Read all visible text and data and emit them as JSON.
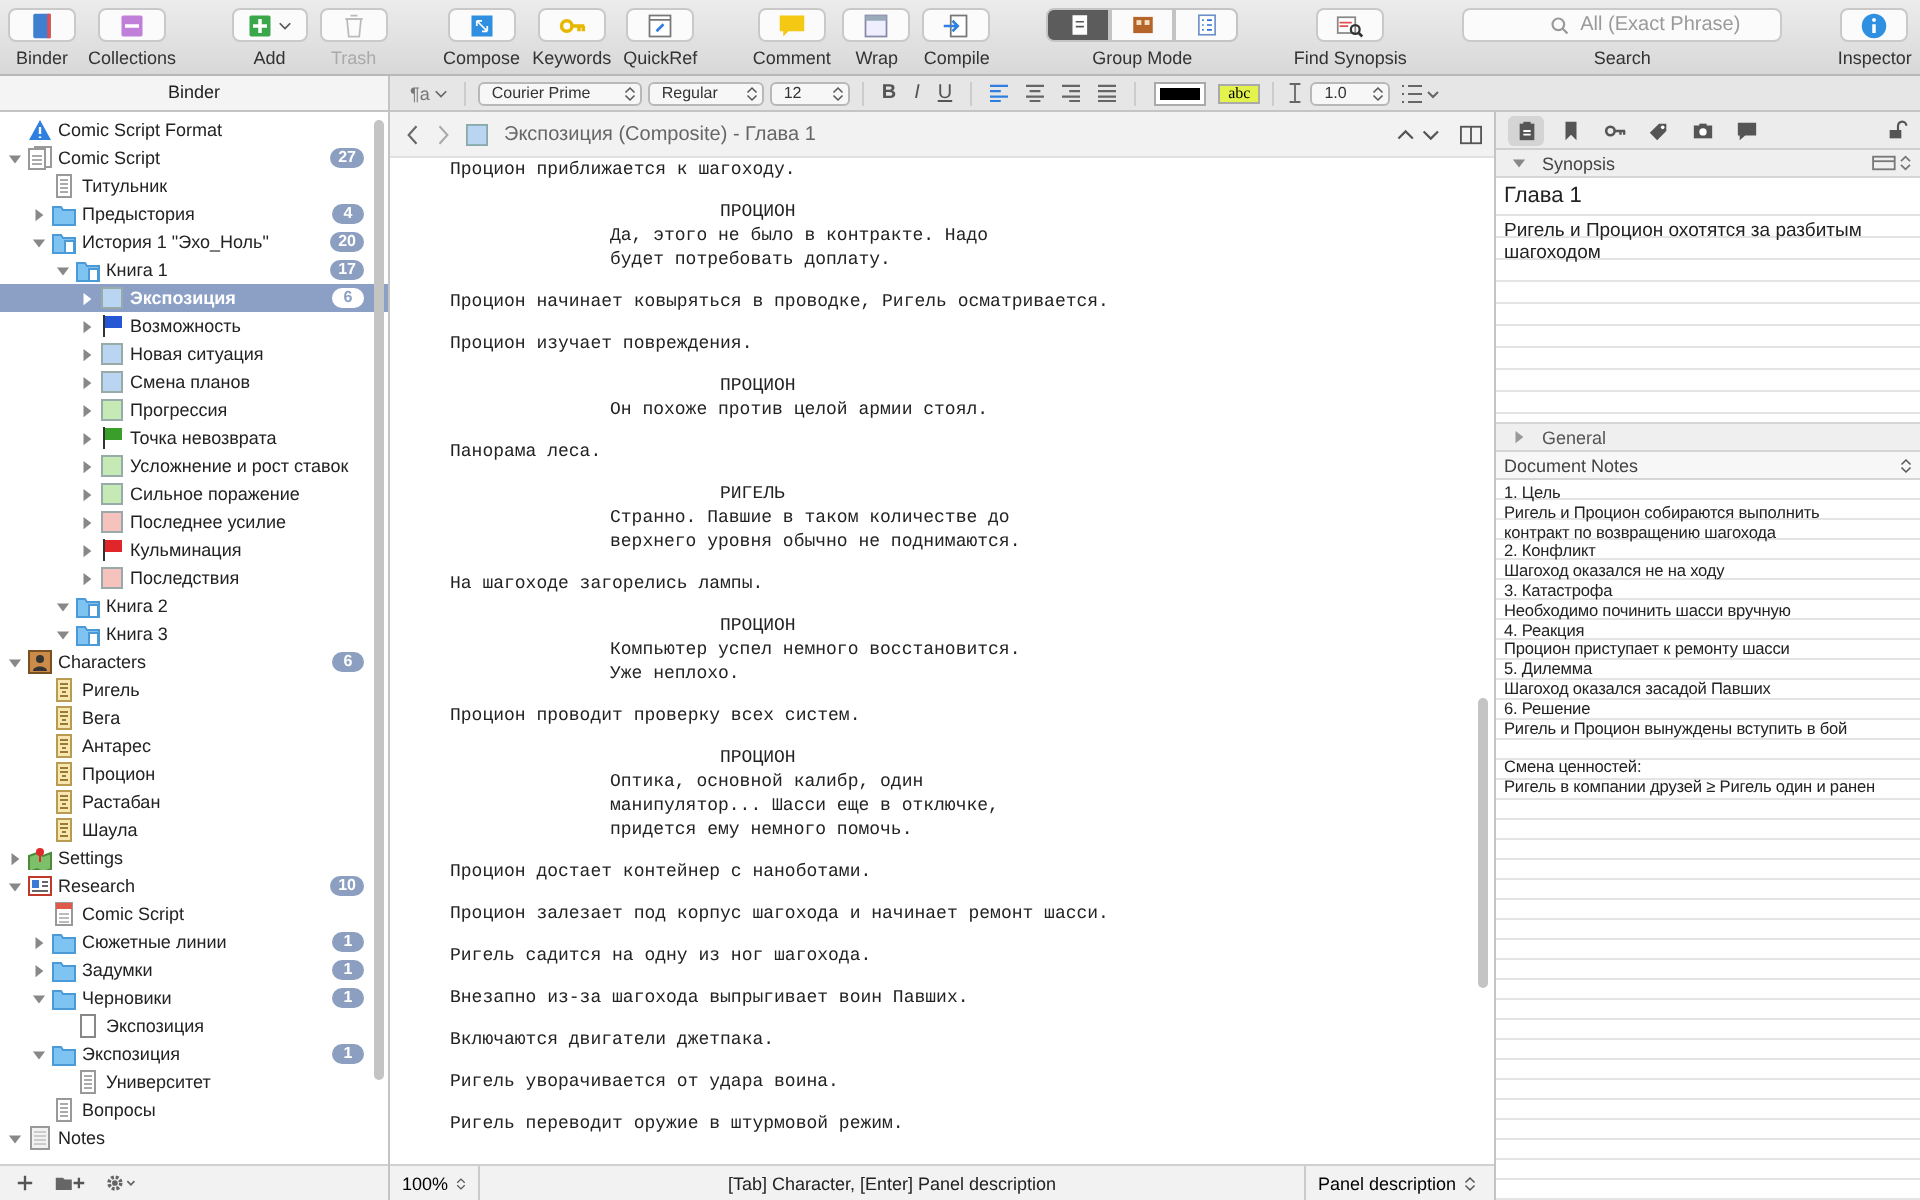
{
  "toolbar": {
    "groups": [
      [
        {
          "kind": "button",
          "label": "Binder"
        },
        {
          "kind": "button",
          "label": "Collections"
        }
      ],
      [
        {
          "kind": "button",
          "label": "Add",
          "dropdown": true
        },
        {
          "kind": "button",
          "label": "Trash",
          "disabled": true
        }
      ],
      [
        {
          "kind": "button",
          "label": "Compose"
        },
        {
          "kind": "button",
          "label": "Keywords"
        },
        {
          "kind": "button",
          "label": "QuickRef"
        }
      ],
      [
        {
          "kind": "button",
          "label": "Comment"
        },
        {
          "kind": "button",
          "label": "Wrap"
        },
        {
          "kind": "button",
          "label": "Compile"
        }
      ],
      [
        {
          "kind": "segmented",
          "label": "Group Mode",
          "segments": [
            {
              "selected": true
            },
            {
              "selected": false
            },
            {
              "selected": false
            }
          ]
        }
      ],
      [
        {
          "kind": "button",
          "label": "Find Synopsis"
        }
      ],
      [
        {
          "kind": "search",
          "label": "Search",
          "placeholder": "All (Exact Phrase)"
        }
      ],
      [
        {
          "kind": "button",
          "label": "Inspector"
        }
      ]
    ]
  },
  "binder": {
    "header": "Binder",
    "items": [
      {
        "label": "Comic Script Format",
        "kind": "warning",
        "selected": false
      },
      {
        "label": "Comic Script",
        "kind": "script",
        "count": "27",
        "expanded": true,
        "selected": false,
        "children": [
          {
            "label": "Титульник",
            "kind": "text",
            "selected": false
          },
          {
            "label": "Предыстория",
            "kind": "folder",
            "count": "4",
            "expanded": false,
            "selected": false
          },
          {
            "label": "История 1 \"Эхо_Ноль\"",
            "kind": "folder-doc",
            "count": "20",
            "expanded": true,
            "selected": false,
            "children": [
              {
                "label": "Книга 1",
                "kind": "folder-doc",
                "count": "17",
                "expanded": true,
                "selected": false,
                "children": [
                  {
                    "label": "Экспозиция",
                    "kind": "card",
                    "color": "#b9d5f2",
                    "count": "6",
                    "expanded": false,
                    "selected": true
                  },
                  {
                    "label": "Возможность",
                    "kind": "flag",
                    "color": "#2456d6",
                    "expanded": false,
                    "selected": false
                  },
                  {
                    "label": "Новая ситуация",
                    "kind": "card",
                    "color": "#b9d5f2",
                    "expanded": false,
                    "selected": false
                  },
                  {
                    "label": "Смена планов",
                    "kind": "card",
                    "color": "#b9d5f2",
                    "expanded": false,
                    "selected": false
                  },
                  {
                    "label": "Прогрессия",
                    "kind": "card",
                    "color": "#c6eab6",
                    "expanded": false,
                    "selected": false
                  },
                  {
                    "label": "Точка невозврата",
                    "kind": "flag",
                    "color": "#3a9e2a",
                    "expanded": false,
                    "selected": false
                  },
                  {
                    "label": "Усложнение и рост ставок",
                    "kind": "card",
                    "color": "#c6eab6",
                    "expanded": false,
                    "selected": false
                  },
                  {
                    "label": "Сильное поражение",
                    "kind": "card",
                    "color": "#c6eab6",
                    "expanded": false,
                    "selected": false
                  },
                  {
                    "label": "Последнее усилие",
                    "kind": "card",
                    "color": "#f5c2bd",
                    "expanded": false,
                    "selected": false
                  },
                  {
                    "label": "Кульминация",
                    "kind": "flag",
                    "color": "#e0262a",
                    "expanded": false,
                    "selected": false
                  },
                  {
                    "label": "Последствия",
                    "kind": "card",
                    "color": "#f5c2bd",
                    "expanded": false,
                    "selected": false
                  }
                ]
              },
              {
                "label": "Книга 2",
                "kind": "folder-doc",
                "expanded": true,
                "selected": false
              },
              {
                "label": "Книга 3",
                "kind": "folder-doc",
                "expanded": true,
                "selected": false
              }
            ]
          }
        ]
      },
      {
        "label": "Characters",
        "kind": "character-folder",
        "count": "6",
        "expanded": true,
        "selected": false,
        "children": [
          {
            "label": "Ригель",
            "kind": "character",
            "selected": false
          },
          {
            "label": "Вега",
            "kind": "character",
            "selected": false
          },
          {
            "label": "Антарес",
            "kind": "character",
            "selected": false
          },
          {
            "label": "Процион",
            "kind": "character",
            "selected": false
          },
          {
            "label": "Растабан",
            "kind": "character",
            "selected": false
          },
          {
            "label": "Шаула",
            "kind": "character",
            "selected": false
          }
        ]
      },
      {
        "label": "Settings",
        "kind": "settings",
        "expanded": false,
        "selected": false
      },
      {
        "label": "Research",
        "kind": "research",
        "count": "10",
        "expanded": true,
        "selected": false,
        "children": [
          {
            "label": "Comic Script",
            "kind": "pdf",
            "selected": false
          },
          {
            "label": "Сюжетные линии",
            "kind": "folder",
            "count": "1",
            "expanded": false,
            "selected": false
          },
          {
            "label": "Задумки",
            "kind": "folder",
            "count": "1",
            "expanded": false,
            "selected": false
          },
          {
            "label": "Черновики",
            "kind": "folder",
            "count": "1",
            "expanded": true,
            "selected": false,
            "children": [
              {
                "label": "Экспозиция",
                "kind": "page",
                "selected": false
              }
            ]
          },
          {
            "label": "Экспозиция",
            "kind": "folder",
            "count": "1",
            "expanded": true,
            "selected": false,
            "children": [
              {
                "label": "Университет",
                "kind": "text",
                "selected": false
              }
            ]
          },
          {
            "label": "Вопросы",
            "kind": "text",
            "selected": false
          }
        ]
      },
      {
        "label": "Notes",
        "kind": "notes",
        "expanded": true,
        "selected": false
      }
    ]
  },
  "format_bar": {
    "style_button": "¶a",
    "font": "Courier Prime",
    "weight": "Regular",
    "size": "12",
    "styles": [
      {
        "label": "B",
        "kind": "bold"
      },
      {
        "label": "I",
        "kind": "italic"
      },
      {
        "label": "U",
        "kind": "underline"
      }
    ],
    "alignments": [
      {
        "kind": "left",
        "selected": true
      },
      {
        "kind": "center",
        "selected": false
      },
      {
        "kind": "right",
        "selected": false
      },
      {
        "kind": "justify",
        "selected": false
      }
    ],
    "highlight": {
      "label": "abc"
    },
    "line_spacing": "1.0"
  },
  "editor": {
    "title": "Экспозиция (Composite) - Глава 1",
    "blocks": [
      {
        "kind": "action",
        "text": "Процион приближается к шагоходу."
      },
      {
        "kind": "character",
        "text": "ПРОЦИОН"
      },
      {
        "kind": "dialogue",
        "text": "Да, этого не было в контракте. Надо\nбудет потребовать доплату."
      },
      {
        "kind": "action",
        "text": "Процион начинает ковыряться в проводке, Ригель осматривается."
      },
      {
        "kind": "action",
        "text": "Процион изучает повреждения."
      },
      {
        "kind": "character",
        "text": "ПРОЦИОН"
      },
      {
        "kind": "dialogue",
        "text": "Он похоже против целой армии стоял."
      },
      {
        "kind": "action",
        "text": "Панорама леса."
      },
      {
        "kind": "character",
        "text": "РИГЕЛЬ"
      },
      {
        "kind": "dialogue",
        "text": "Странно. Павшие в таком количестве до\nверхнего уровня обычно не поднимаются."
      },
      {
        "kind": "action",
        "text": "На шагоходе загорелись лампы."
      },
      {
        "kind": "character",
        "text": "ПРОЦИОН"
      },
      {
        "kind": "dialogue",
        "text": "Компьютер успел немного восстановится.\nУже неплохо."
      },
      {
        "kind": "action",
        "text": "Процион проводит проверку всех систем."
      },
      {
        "kind": "character",
        "text": "ПРОЦИОН"
      },
      {
        "kind": "dialogue",
        "text": "Оптика, основной калибр, один\nманипулятор... Шасси еще в отключке,\nпридется ему немного помочь."
      },
      {
        "kind": "action",
        "text": "Процион достает контейнер с наноботами."
      },
      {
        "kind": "action",
        "text": "Процион залезает под корпус шагохода и начинает ремонт шасси."
      },
      {
        "kind": "action",
        "text": "Ригель садится на одну из ног шагохода."
      },
      {
        "kind": "action",
        "text": "Внезапно из-за шагохода выпрыгивает воин Павших."
      },
      {
        "kind": "action",
        "text": "Включаются двигатели джетпака."
      },
      {
        "kind": "action",
        "text": "Ригель уворачивается от удара воина."
      },
      {
        "kind": "action",
        "text": "Ригель переводит оружие в штурмовой режим."
      }
    ],
    "footer": {
      "zoom": "100%",
      "hint": "[Tab] Character, [Enter] Panel description",
      "element": "Panel description"
    }
  },
  "inspector": {
    "tabs": [
      {
        "selected": true
      },
      {
        "selected": false
      },
      {
        "selected": false
      },
      {
        "selected": false
      },
      {
        "selected": false
      },
      {
        "selected": false
      }
    ],
    "synopsis": {
      "header": "Synopsis",
      "expanded": true,
      "title": "Глава 1",
      "text": "Ригель и Процион охотятся за разбитым шагоходом"
    },
    "general": {
      "label": "General",
      "expanded": false
    },
    "notes": {
      "header": "Document Notes",
      "blocks": [
        [
          "1. Цель",
          "Ригель и Процион собираются выполнить",
          "контракт по возвращению шагохода",
          "2. Конфликт",
          "Шагоход оказался не на ходу",
          "3. Катастрофа",
          "Необходимо починить шасси вручную",
          "4. Реакция",
          "Процион приступает к ремонту шасси",
          "5. Дилемма",
          "Шагоход оказался засадой Павших",
          "6. Решение",
          "Ригель и Процион вынуждены вступить в бой"
        ],
        [
          "Смена ценностей:",
          "Ригель в компании друзей ≥ Ригель один и ранен"
        ]
      ]
    }
  }
}
